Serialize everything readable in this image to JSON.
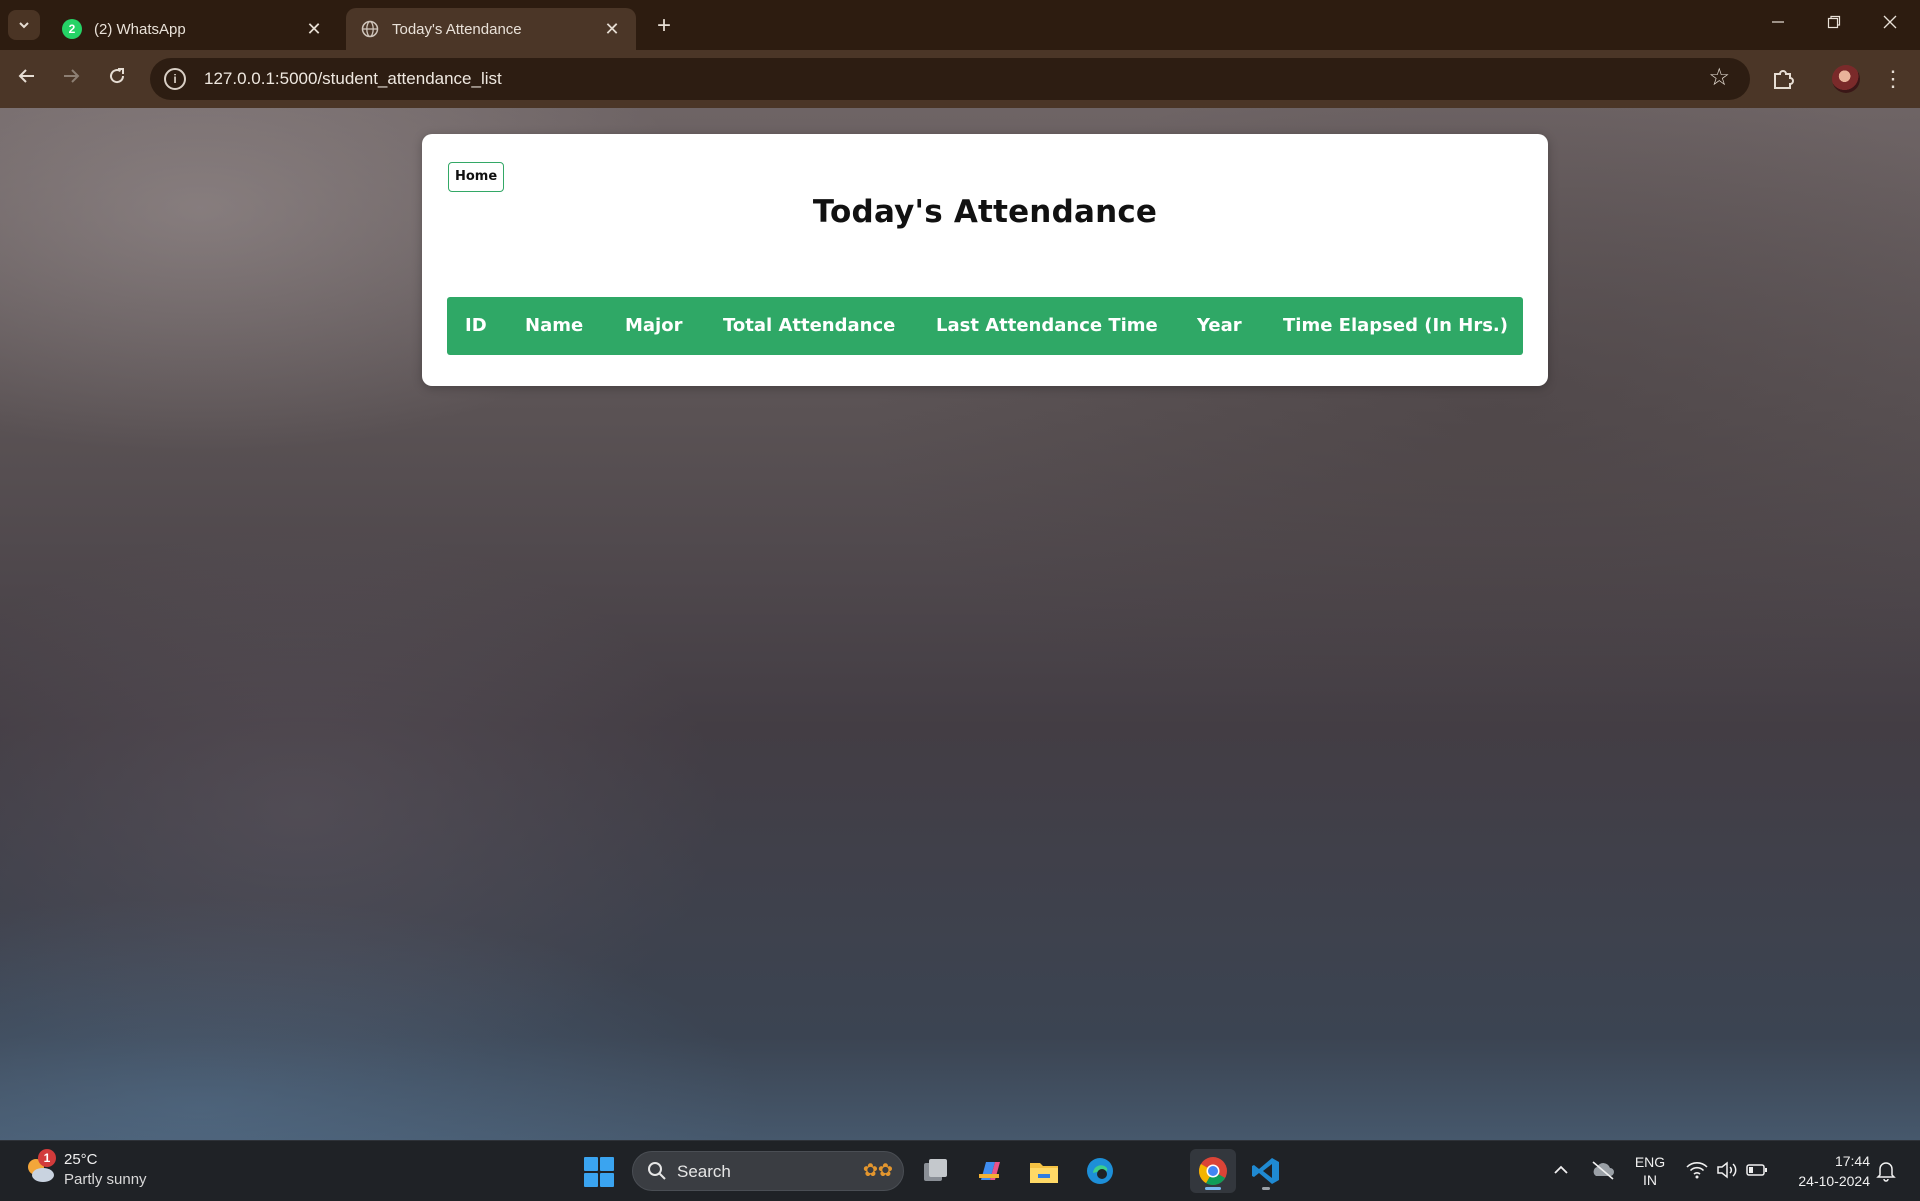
{
  "browser": {
    "tabs": [
      {
        "title": "(2) WhatsApp",
        "badge": "2",
        "active": false
      },
      {
        "title": "Today's Attendance",
        "active": true
      }
    ],
    "url": "127.0.0.1:5000/student_attendance_list"
  },
  "page": {
    "home_label": "Home",
    "title": "Today's Attendance",
    "table": {
      "columns": [
        "ID",
        "Name",
        "Major",
        "Total Attendance",
        "Last Attendance Time",
        "Year",
        "Time Elapsed (In Hrs.)"
      ],
      "rows": []
    },
    "accent_color": "#2fa866"
  },
  "taskbar": {
    "weather": {
      "badge": "1",
      "temp": "25°C",
      "desc": "Partly sunny"
    },
    "search_label": "Search",
    "language": {
      "line1": "ENG",
      "line2": "IN"
    },
    "clock": {
      "time": "17:44",
      "date": "24-10-2024"
    }
  }
}
